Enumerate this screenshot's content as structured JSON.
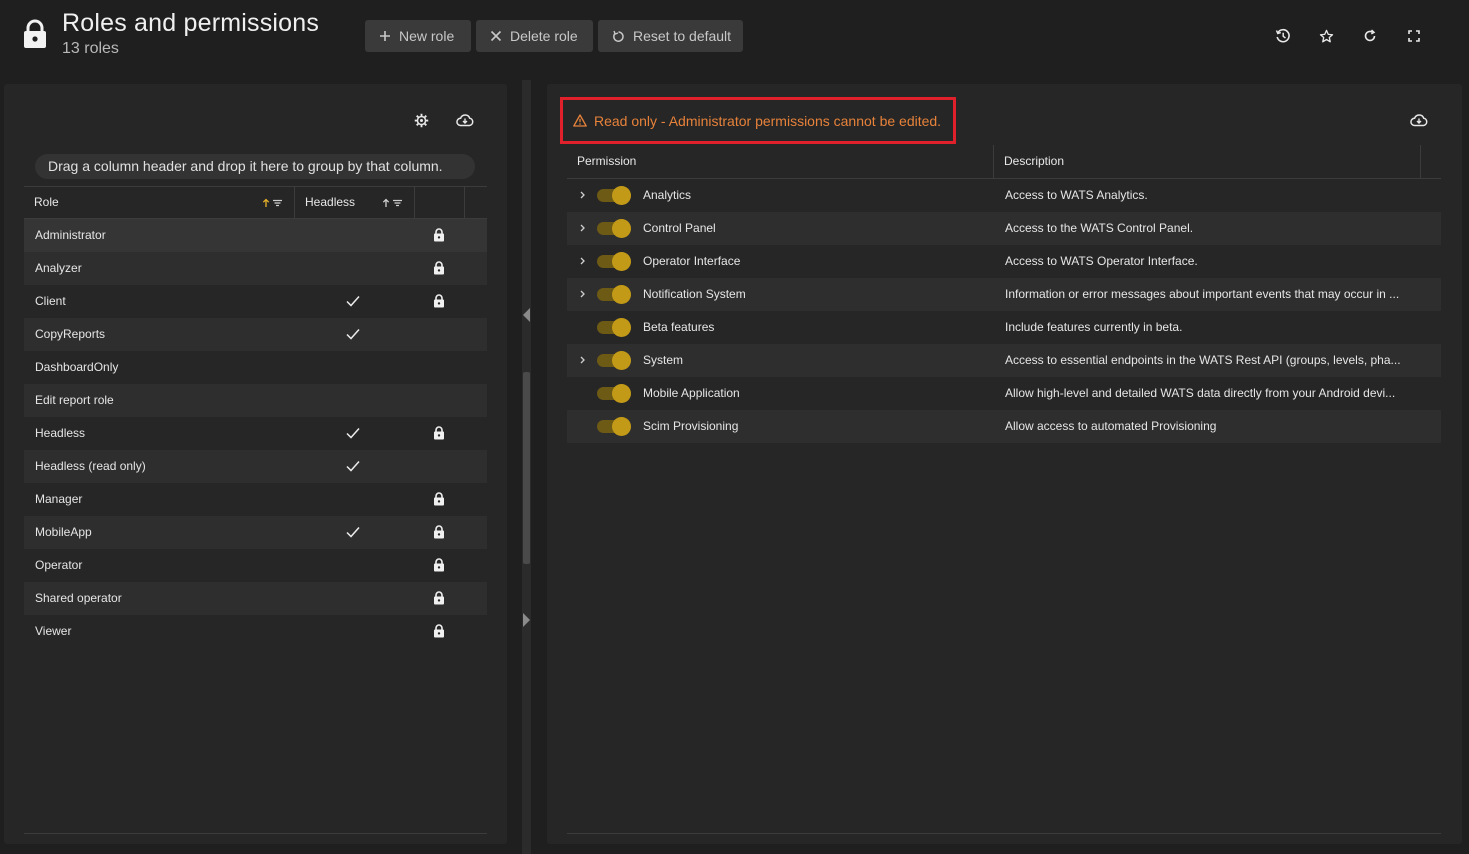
{
  "header": {
    "title": "Roles and permissions",
    "subtitle": "13 roles",
    "buttons": {
      "new_role": "New role",
      "delete_role": "Delete role",
      "reset_default": "Reset to default"
    },
    "icons": [
      "lock-icon",
      "history-icon",
      "star-icon",
      "refresh-icon",
      "fullscreen-icon"
    ]
  },
  "roles_panel": {
    "group_hint": "Drag a column header and drop it here to group by that column.",
    "columns": {
      "role": "Role",
      "headless": "Headless"
    },
    "rows": [
      {
        "name": "Administrator",
        "headless": false,
        "locked": true
      },
      {
        "name": "Analyzer",
        "headless": false,
        "locked": true
      },
      {
        "name": "Client",
        "headless": true,
        "locked": true
      },
      {
        "name": "CopyReports",
        "headless": true,
        "locked": false
      },
      {
        "name": "DashboardOnly",
        "headless": false,
        "locked": false
      },
      {
        "name": "Edit report role",
        "headless": false,
        "locked": false
      },
      {
        "name": "Headless",
        "headless": true,
        "locked": true
      },
      {
        "name": "Headless (read only)",
        "headless": true,
        "locked": false
      },
      {
        "name": "Manager",
        "headless": false,
        "locked": true
      },
      {
        "name": "MobileApp",
        "headless": true,
        "locked": true
      },
      {
        "name": "Operator",
        "headless": false,
        "locked": true
      },
      {
        "name": "Shared operator",
        "headless": false,
        "locked": true
      },
      {
        "name": "Viewer",
        "headless": false,
        "locked": true
      }
    ]
  },
  "permissions_panel": {
    "warning": "Read only - Administrator permissions cannot be edited.",
    "columns": {
      "permission": "Permission",
      "description": "Description"
    },
    "rows": [
      {
        "name": "Analytics",
        "description": "Access to WATS Analytics.",
        "expandable": true,
        "enabled": true
      },
      {
        "name": "Control Panel",
        "description": "Access to the WATS Control Panel.",
        "expandable": true,
        "enabled": true
      },
      {
        "name": "Operator Interface",
        "description": "Access to WATS Operator Interface.",
        "expandable": true,
        "enabled": true
      },
      {
        "name": "Notification System",
        "description": "Information or error messages about important events that may occur in ...",
        "expandable": true,
        "enabled": true
      },
      {
        "name": "Beta features",
        "description": "Include features currently in beta.",
        "expandable": false,
        "enabled": true
      },
      {
        "name": "System",
        "description": "Access to essential endpoints in the WATS Rest API (groups, levels, pha...",
        "expandable": true,
        "enabled": true
      },
      {
        "name": "Mobile Application",
        "description": "Allow high-level and detailed WATS data directly from your Android devi...",
        "expandable": false,
        "enabled": true
      },
      {
        "name": "Scim Provisioning",
        "description": "Allow access to automated Provisioning",
        "expandable": false,
        "enabled": true
      }
    ]
  },
  "colors": {
    "accent_toggle": "#c39a18",
    "warning_text": "#e7823a",
    "warning_border": "#e0202a",
    "background": "#1f1f1f",
    "panel": "#262626"
  }
}
